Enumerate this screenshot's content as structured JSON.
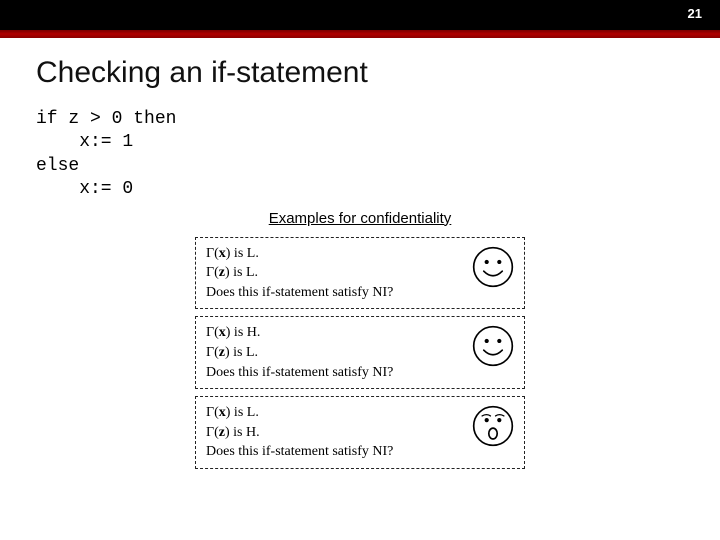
{
  "page_number": "21",
  "title": "Checking an if-statement",
  "code": "if z > 0 then\n    x:= 1\nelse\n    x:= 0",
  "examples_header": "Examples for confidentiality",
  "boxes": [
    {
      "line1_var": "x",
      "line1_label": "L",
      "line2_var": "z",
      "line2_label": "L",
      "question": "Does this if-statement satisfy NI?",
      "face": "smile"
    },
    {
      "line1_var": "x",
      "line1_label": "H",
      "line2_var": "z",
      "line2_label": "L",
      "question": "Does this if-statement satisfy NI?",
      "face": "smile"
    },
    {
      "line1_var": "x",
      "line1_label": "L",
      "line2_var": "z",
      "line2_label": "H",
      "question": "Does this if-statement satisfy NI?",
      "face": "surprise"
    }
  ]
}
